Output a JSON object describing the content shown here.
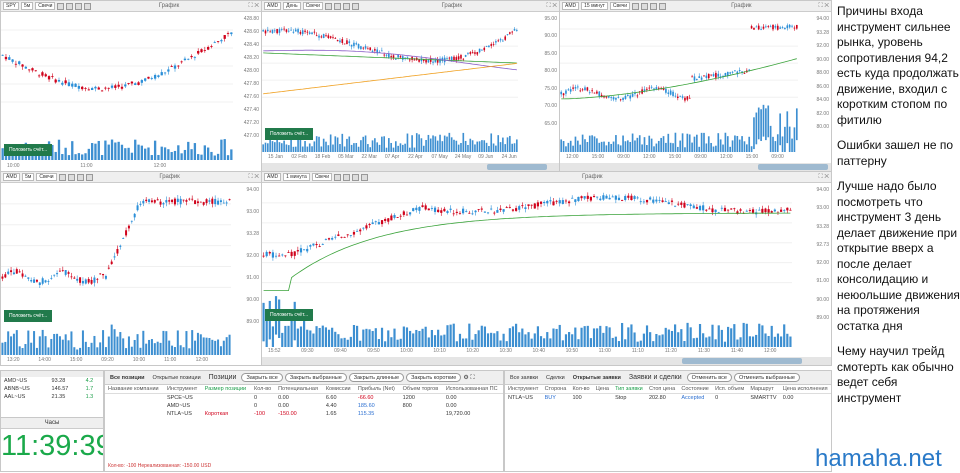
{
  "charts": [
    {
      "symbol": "SPY",
      "tf": "5м",
      "ct": "Свечи",
      "title": "График",
      "y_labels": [
        "428.80",
        "428.60",
        "428.40",
        "428.20",
        "428.00",
        "427.80",
        "427.60",
        "427.40",
        "427.20",
        "427.00"
      ],
      "price_tag": "428.05",
      "x_labels": [
        "10:00",
        "11:00",
        "12:00"
      ],
      "vol_tag": "323,417",
      "btn": "Положить счёт..."
    },
    {
      "symbol": "AMD",
      "tf": "День",
      "ct": "Свечи",
      "title": "График",
      "y_labels": [
        "95.00",
        "90.00",
        "85.00",
        "80.00",
        "75.00",
        "70.00",
        "65.00"
      ],
      "tags": [
        "93.28",
        "88.00",
        "83.61",
        "82.02"
      ],
      "x_labels": [
        "15 Jan",
        "02 Feb",
        "18 Feb",
        "05 Mar",
        "22 Mar",
        "07 Apr",
        "22 Apr",
        "07 May",
        "24 May",
        "09 Jun",
        "24 Jun"
      ],
      "vol_labels": [
        "100,000,000",
        "38,958,649"
      ],
      "btn": "Положить счёт..."
    },
    {
      "symbol": "AMD",
      "tf": "15 минут",
      "ct": "Свечи",
      "title": "График",
      "y_labels": [
        "94.00",
        "93.28",
        "92.00",
        "90.00",
        "88.00",
        "86.00",
        "84.00",
        "82.00",
        "80.00"
      ],
      "x_labels": [
        "12:00",
        "15:00",
        "09:00",
        "12:00",
        "15:00",
        "09:00",
        "12:00",
        "15:00",
        "09:00"
      ],
      "vol_tag": "658,234",
      "btn": "Положить счёт..."
    },
    {
      "symbol": "AMD",
      "tf": "5м",
      "ct": "Свечи",
      "title": "График",
      "y_labels": [
        "94.00",
        "93.00",
        "93.28",
        "92.00",
        "91.00",
        "90.00",
        "89.00"
      ],
      "x_labels": [
        "13:20",
        "14:00",
        "15:00",
        "09:20",
        "10:00",
        "11:00",
        "12:00"
      ],
      "vol_tag": "309,439",
      "btn": "Положить счёт..."
    },
    {
      "symbol": "AMD",
      "tf": "1 минута",
      "ct": "Свечи",
      "title": "График",
      "y_labels": [
        "94.00",
        "93.00",
        "93.28",
        "92.73",
        "92.00",
        "91.00",
        "90.00",
        "89.00"
      ],
      "x_labels": [
        "15:52",
        "09:30",
        "09:40",
        "09:50",
        "10:00",
        "10:10",
        "10:20",
        "10:30",
        "10:40",
        "10:50",
        "11:00",
        "11:10",
        "11:20",
        "11:30",
        "11:40",
        "12:00"
      ],
      "vol_labels": [
        "2,000,000",
        "55,809"
      ],
      "btn": "Положить счёт..."
    }
  ],
  "watchlist": [
    {
      "sym": "AMD~US",
      "px": "93.28",
      "chg": "4.2"
    },
    {
      "sym": "ABNB~US",
      "px": "146.57",
      "chg": "1.7"
    },
    {
      "sym": "AAL~US",
      "px": "21.35",
      "chg": "1.3"
    }
  ],
  "clock": {
    "title": "Часы",
    "time": "11:39:39"
  },
  "positions": {
    "tabs": [
      "Все позиции",
      "Открытые позиции"
    ],
    "panel_title": "Позиции",
    "buttons": [
      "Закрыть все",
      "Закрыть выбранные",
      "Закрыть длинные",
      "Закрыть короткие"
    ],
    "headers": [
      "Название компании",
      "Инструмент",
      "Размер позиции",
      "Кол-во",
      "Потенциальная",
      "Комиссии",
      "Прибыль (Net)",
      "Объем торгов",
      "Использованная ПС"
    ],
    "rows": [
      [
        "",
        "SPCE~US",
        "",
        "0",
        "0.00",
        "6.60",
        "-66.60",
        "1200",
        "0.00"
      ],
      [
        "",
        "AMD~US",
        "",
        "0",
        "0.00",
        "4.40",
        "185.60",
        "800",
        "0.00"
      ],
      [
        "",
        "NTLA~US",
        "Короткая",
        "-100",
        "-150.00",
        "1.65",
        "115.35",
        "",
        "19,720.00"
      ]
    ],
    "footer": "Кол-во: -100  Нереализованная: -150.00 USD"
  },
  "orders": {
    "tabs": [
      "Все заявки",
      "Сделки",
      "Открытые заявки"
    ],
    "panel_title": "Заявки и сделки",
    "buttons": [
      "Отменить все",
      "Отменить выбранные"
    ],
    "headers": [
      "Инструмент",
      "Сторона",
      "Кол-во",
      "Цена",
      "Тип заявки",
      "Стоп цена",
      "Состояние",
      "Исп. объем",
      "Маршрут",
      "Цена исполнения"
    ],
    "rows": [
      [
        "NTLA~US",
        "BUY",
        "100",
        "",
        "Stop",
        "202.80",
        "Accepted",
        "0",
        "SMARTTV",
        "0.00"
      ]
    ]
  },
  "notes": [
    "Причины входа инструмент сильнее рынка, уровень сопротивления 94,2 есть куда продолжать движение, входил с коротким стопом по фитилю",
    "Ошибки зашел не по паттерну",
    "Лучше надо было посмотреть что инструмент 3 день делает движение при открытие вверх а после делает консолидацию и неюольшие движения на протяжения остатка дня",
    "Чему научил трейд смотерть как обычно ведет себя инструмент"
  ],
  "watermark": "hamaha.net",
  "colors": {
    "up": "#2b8fd8",
    "down": "#d0021b",
    "ma": "#3ba33b",
    "ma2": "#8a5fc7",
    "ma3": "#f0a020",
    "button": "#217a4b",
    "clock": "#1aa94a"
  }
}
